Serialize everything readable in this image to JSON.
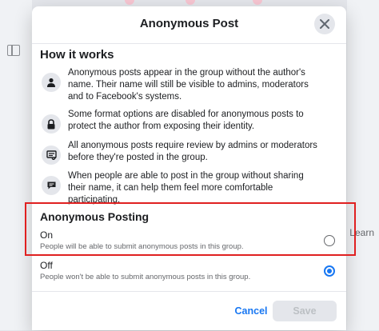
{
  "dialog": {
    "title": "Anonymous Post"
  },
  "how_it_works": {
    "title": "How it works",
    "items": [
      {
        "icon": "person-icon",
        "text": "Anonymous posts appear in the group without the author's name. Their name will still be visible to admins, moderators and to Facebook's systems."
      },
      {
        "icon": "lock-icon",
        "text": "Some format options are disabled for anonymous posts to protect the author from exposing their identity."
      },
      {
        "icon": "review-icon",
        "text": "All anonymous posts require review by admins or moderators before they're posted in the group."
      },
      {
        "icon": "chat-icon",
        "text": "When people are able to post in the group without sharing their name, it can help them feel more comfortable participating."
      }
    ]
  },
  "anonymous_posting": {
    "title": "Anonymous Posting",
    "options": [
      {
        "label": "On",
        "description": "People will be able to submit anonymous posts in this group.",
        "selected": false
      },
      {
        "label": "Off",
        "description": "People won't be able to submit anonymous posts in this group.",
        "selected": true
      }
    ]
  },
  "footer": {
    "cancel_label": "Cancel",
    "save_label": "Save"
  },
  "background": {
    "right_link": "Learn"
  },
  "colors": {
    "accent": "#1877f2",
    "highlight_border": "#e02020",
    "disabled_button": "#e4e6eb"
  }
}
